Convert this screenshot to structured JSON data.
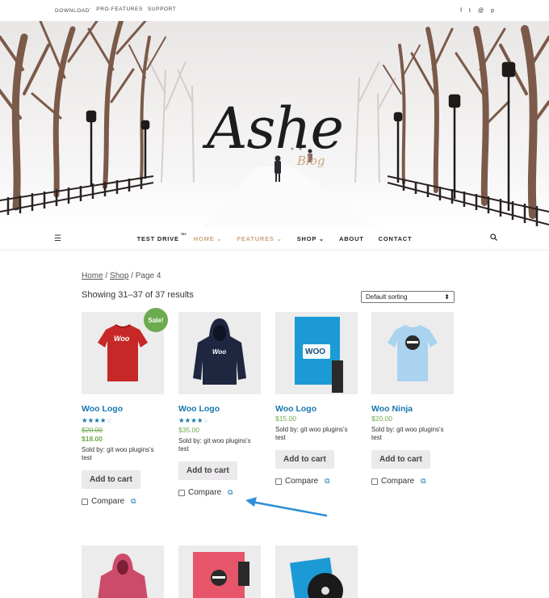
{
  "topbar": {
    "links": [
      "DOWNLOAD",
      "PRO-FEATURES",
      "SUPPORT"
    ],
    "download_sup": "*",
    "social": [
      "f",
      "t",
      "@",
      "p"
    ]
  },
  "logo": {
    "main": "Ashe",
    "sub": "Blog"
  },
  "nav": {
    "items": [
      {
        "label": "TEST DRIVE",
        "sup": "TRY"
      },
      {
        "label": "HOME ⌄"
      },
      {
        "label": "FEATURES ⌄"
      },
      {
        "label": "SHOP ⌄"
      },
      {
        "label": "ABOUT"
      },
      {
        "label": "CONTACT"
      }
    ],
    "menu_icon": "menu-icon",
    "search_icon": "search-icon"
  },
  "breadcrumb": {
    "home": "Home",
    "shop": "Shop",
    "sep": " / ",
    "page": "Page 4"
  },
  "results": "Showing 31–37 of 37 results",
  "sorting": {
    "selected": "Default sorting",
    "arrow": "⬍"
  },
  "products": [
    {
      "title": "Woo Logo",
      "sale": "Sale!",
      "stars": 4,
      "old_price": "$20.00",
      "price": "$18.00",
      "seller": "Sold by: git woo plugins's test",
      "button": "Add to cart",
      "compare": "Compare"
    },
    {
      "title": "Woo Logo",
      "stars": 4,
      "price": "$35.00",
      "seller": "Sold by: git woo plugins's test",
      "button": "Add to cart",
      "compare": "Compare"
    },
    {
      "title": "Woo Logo",
      "price": "$15.00",
      "seller": "Sold by: git woo plugins's test",
      "button": "Add to cart",
      "compare": "Compare"
    },
    {
      "title": "Woo Ninja",
      "price": "$20.00",
      "seller": "Sold by: git woo plugins's test",
      "button": "Add to cart",
      "compare": "Compare"
    }
  ],
  "thumb_labels": {
    "woo": "Woo",
    "woo_caps": "WOO"
  },
  "colors": {
    "link": "#1877b0",
    "price": "#6cab4f",
    "accent": "#cba57d",
    "annotation": "#2f8fd6"
  }
}
